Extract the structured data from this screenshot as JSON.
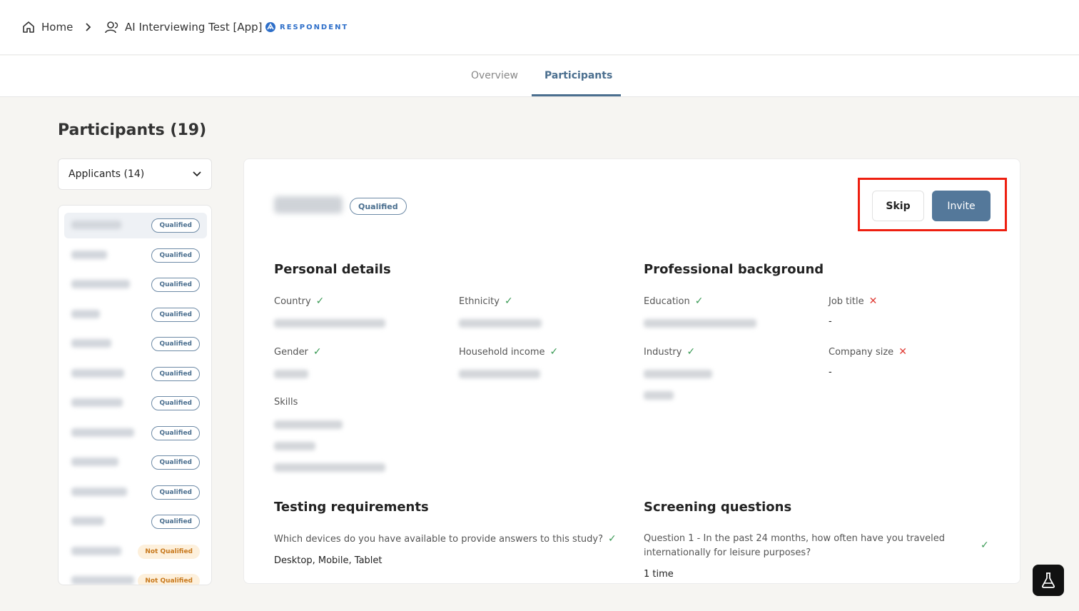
{
  "breadcrumb": {
    "home_label": "Home",
    "study_label": "AI Interviewing Test [App]",
    "brand": "RESPONDENT"
  },
  "tabs": [
    {
      "label": "Overview",
      "active": false
    },
    {
      "label": "Participants",
      "active": true
    }
  ],
  "page_title": "Participants (19)",
  "filter": {
    "selected": "Applicants (14)"
  },
  "participants": [
    {
      "status": "Qualified",
      "selected": true
    },
    {
      "status": "Qualified"
    },
    {
      "status": "Qualified"
    },
    {
      "status": "Qualified"
    },
    {
      "status": "Qualified"
    },
    {
      "status": "Qualified"
    },
    {
      "status": "Qualified"
    },
    {
      "status": "Qualified"
    },
    {
      "status": "Qualified"
    },
    {
      "status": "Qualified"
    },
    {
      "status": "Qualified"
    },
    {
      "status": "Not Qualified"
    },
    {
      "status": "Not Qualified"
    }
  ],
  "candidate": {
    "status": "Qualified",
    "skip_label": "Skip",
    "invite_label": "Invite"
  },
  "personal": {
    "title": "Personal details",
    "country_label": "Country",
    "ethnicity_label": "Ethnicity",
    "gender_label": "Gender",
    "income_label": "Household income",
    "skills_label": "Skills"
  },
  "professional": {
    "title": "Professional background",
    "education_label": "Education",
    "jobtitle_label": "Job title",
    "jobtitle_value": "-",
    "industry_label": "Industry",
    "company_label": "Company size",
    "company_value": "-"
  },
  "testing": {
    "title": "Testing requirements",
    "question": "Which devices do you have available to provide answers to this study?",
    "answer": "Desktop, Mobile, Tablet"
  },
  "screening": {
    "title": "Screening questions",
    "question_line1": "Question 1 - In the past 24 months, how often have you traveled",
    "question_line2": "internationally for leisure purposes?",
    "answer": "1 time"
  },
  "colors": {
    "accent": "#54789a",
    "highlight": "#ee1f10",
    "check": "#3a9a55",
    "cross": "#e03b34",
    "not_qualified_bg": "#fdf0dc",
    "not_qualified_text": "#c8791d"
  }
}
